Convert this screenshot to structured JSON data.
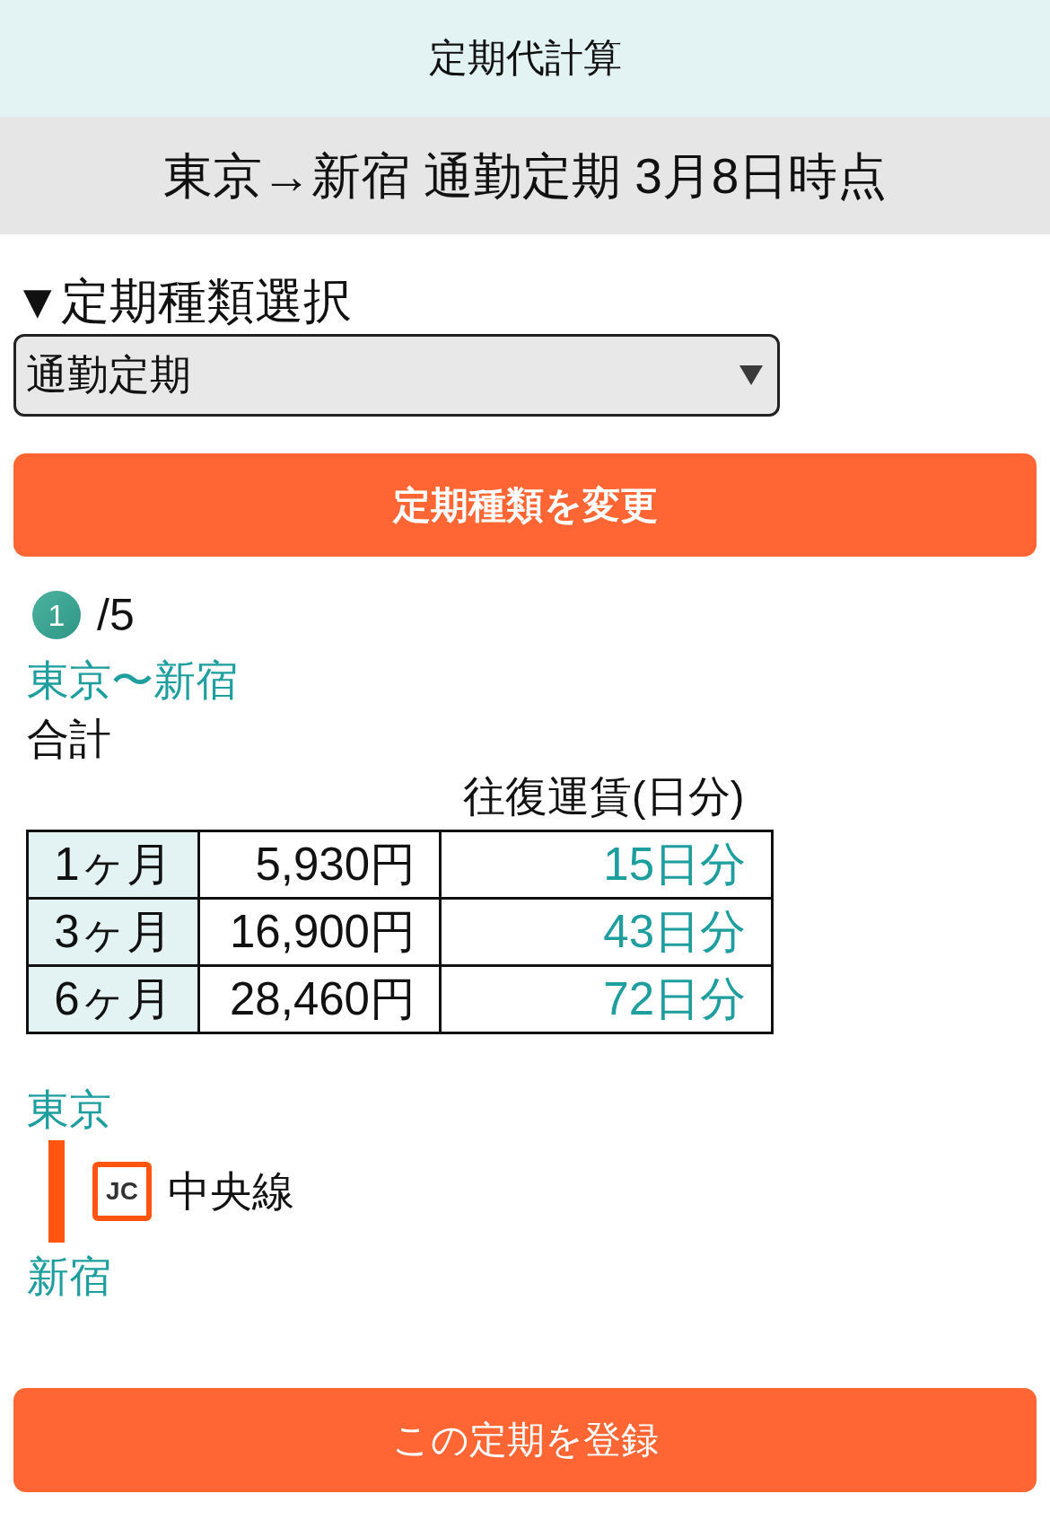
{
  "header": {
    "title": "定期代計算"
  },
  "route_banner": {
    "text": "東京→新宿 通勤定期 3月8日時点"
  },
  "pass_type": {
    "label": "▼定期種類選択",
    "select_value": "通勤定期",
    "change_button": "定期種類を変更"
  },
  "route_counter": {
    "current": "1",
    "total": "/5"
  },
  "route_summary": {
    "title": "東京〜新宿",
    "subtitle": "合計"
  },
  "fare_table": {
    "header": "往復運賃(日分)",
    "rows": [
      {
        "period": "1ヶ月",
        "fare": "5,930円",
        "days": "15日分"
      },
      {
        "period": "3ヶ月",
        "fare": "16,900円",
        "days": "43日分"
      },
      {
        "period": "6ヶ月",
        "fare": "28,460円",
        "days": "72日分"
      }
    ]
  },
  "route_detail": {
    "stops": [
      {
        "kind": "station",
        "name": "東京"
      },
      {
        "kind": "line",
        "code": "JC",
        "name": "中央線",
        "color": "#ff5511"
      },
      {
        "kind": "station",
        "name": "新宿"
      }
    ]
  },
  "register_button": "この定期を登録"
}
